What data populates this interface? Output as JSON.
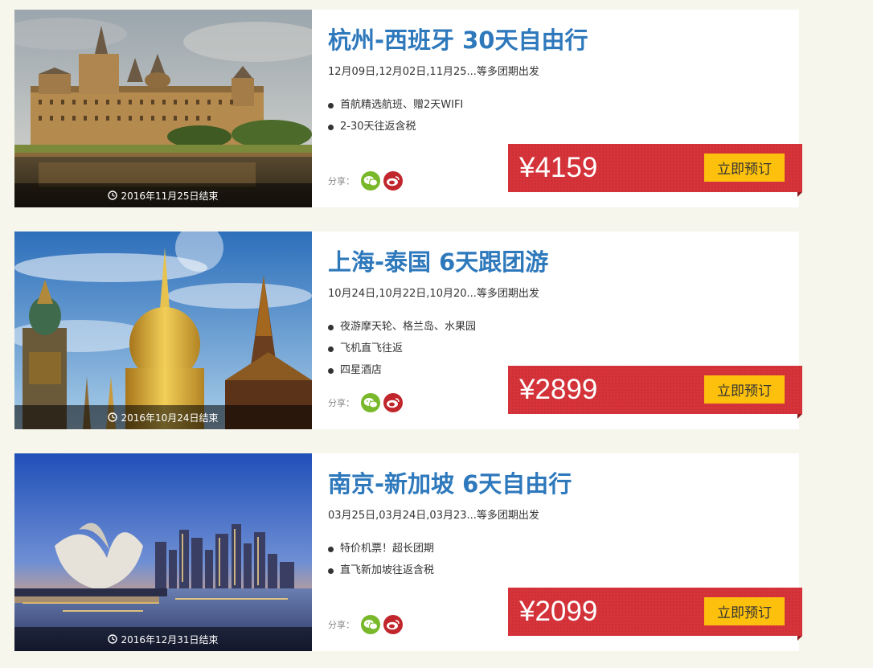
{
  "share_label": "分享：",
  "colors": {
    "page_bg": "#f6f6ec",
    "title": "#2e78bc",
    "price_bg": "#d6333a",
    "button_bg": "#fdc10d",
    "wechat": "#79b82a",
    "weibo": "#c1262c"
  },
  "icons": {
    "clock": "clock-icon",
    "bullet": "bullet-icon",
    "share_wechat": "wechat-icon",
    "share_weibo": "weibo-icon"
  },
  "tours": [
    {
      "title": "杭州-西班牙 30天自由行",
      "dates": "12月09日,12月02日,11月25...等多团期出发",
      "features": [
        "首航精选航班、赠2天WIFI",
        "2-30天往返含税"
      ],
      "end_date": "2016年11月25日结束",
      "price": "¥4159",
      "book_label": "立即预订"
    },
    {
      "title": "上海-泰国 6天跟团游",
      "dates": "10月24日,10月22日,10月20...等多团期出发",
      "features": [
        "夜游摩天轮、格兰岛、水果园",
        "飞机直飞往返",
        "四星酒店"
      ],
      "end_date": "2016年10月24日结束",
      "price": "¥2899",
      "book_label": "立即预订"
    },
    {
      "title": "南京-新加坡 6天自由行",
      "dates": "03月25日,03月24日,03月23...等多团期出发",
      "features": [
        "特价机票！超长团期",
        "直飞新加坡往返含税"
      ],
      "end_date": "2016年12月31日结束",
      "price": "¥2099",
      "book_label": "立即预订"
    }
  ]
}
